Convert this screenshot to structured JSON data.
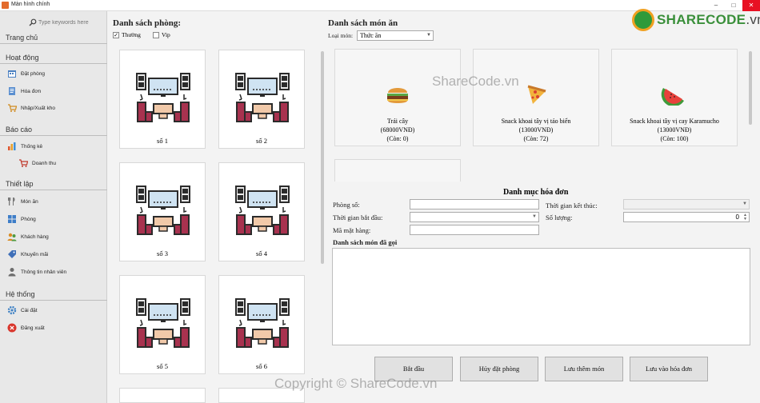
{
  "window": {
    "title": "Màn hình chính"
  },
  "search": {
    "placeholder": "Type keywords here"
  },
  "sidebar": {
    "home": "Trang chủ",
    "sections": [
      {
        "label": "Hoạt động"
      },
      {
        "label": "Báo cáo"
      },
      {
        "label": "Thiết lập"
      },
      {
        "label": "Hệ thống"
      }
    ],
    "items": [
      {
        "label": "Đặt phòng",
        "icon": "calendar-icon"
      },
      {
        "label": "Hóa đơn",
        "icon": "invoice-icon"
      },
      {
        "label": "Nhập/Xuất kho",
        "icon": "cart-icon"
      },
      {
        "label": "Thống kê",
        "icon": "chart-icon"
      },
      {
        "label": "Doanh thu",
        "icon": "cart-icon"
      },
      {
        "label": "Món ăn",
        "icon": "cutlery-icon"
      },
      {
        "label": "Phòng",
        "icon": "grid-icon"
      },
      {
        "label": "Khách hàng",
        "icon": "customer-icon"
      },
      {
        "label": "Khuyến mãi",
        "icon": "tag-icon"
      },
      {
        "label": "Thông tin nhân viên",
        "icon": "person-icon"
      },
      {
        "label": "Cài đặt",
        "icon": "gear-icon"
      },
      {
        "label": "Đăng xuất",
        "icon": "logout-icon"
      }
    ]
  },
  "rooms": {
    "title": "Danh sách phòng:",
    "filters": [
      {
        "label": "Thường",
        "checked": true
      },
      {
        "label": "Vip",
        "checked": false
      }
    ],
    "items": [
      {
        "label": "số 1"
      },
      {
        "label": "số 2"
      },
      {
        "label": "số 3"
      },
      {
        "label": "số 4"
      },
      {
        "label": "số 5"
      },
      {
        "label": "số 6"
      }
    ]
  },
  "foods": {
    "title": "Danh sách món ăn",
    "category_label": "Loại món:",
    "category_value": "Thức ăn",
    "items": [
      {
        "name": "Trái cây",
        "price": "(68000VNĐ)",
        "stock": "(Còn: 0)",
        "icon": "burger-icon"
      },
      {
        "name": "Snack khoai tây vị tảo biển",
        "price": "(13000VNĐ)",
        "stock": "(Còn: 72)",
        "icon": "pizza-icon"
      },
      {
        "name": "Snack khoai tây vị cay Karamucho",
        "price": "(13000VNĐ)",
        "stock": "(Còn: 100)",
        "icon": "watermelon-icon"
      }
    ]
  },
  "invoice": {
    "title": "Danh mục hóa đơn",
    "room_label": "Phòng số:",
    "start_label": "Thời gian bắt đầu:",
    "item_code_label": "Mã mặt hàng:",
    "end_label": "Thời gian kết thúc:",
    "qty_label": "Số lượng:",
    "qty_value": "0",
    "ordered_label": "Danh sách món đã gọi"
  },
  "buttons": {
    "start": "Bắt đầu",
    "cancel": "Hủy đặt phòng",
    "save_item": "Lưu thêm món",
    "save_invoice": "Lưu vào hóa đơn"
  },
  "watermarks": {
    "center": "ShareCode.vn",
    "bottom": "Copyright © ShareCode.vn",
    "logo_main": "SHARECODE",
    "logo_domain": ".vn"
  },
  "colors": {
    "close": "#e81123",
    "logo_green": "#3a8f3a",
    "sofa": "#a8324f"
  }
}
